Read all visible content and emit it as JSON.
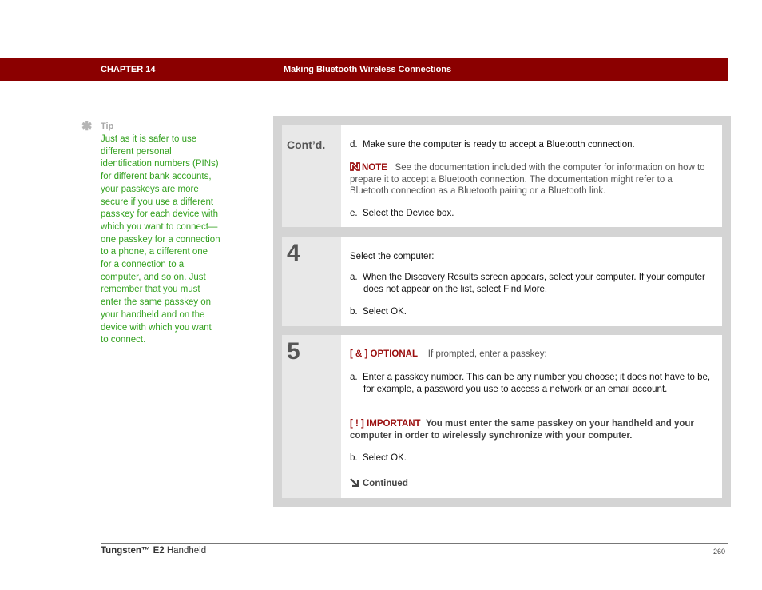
{
  "header": {
    "chapter": "CHAPTER 14",
    "title": "Making Bluetooth Wireless Connections",
    "bar_color": "#8b0000"
  },
  "tip": {
    "icon": "asterisk-icon",
    "label": "Tip",
    "text": "Just as it is safer to use different personal identification numbers (PINs) for different bank accounts, your passkeys are more secure if you use a different passkey for each device with which you want to connect—one passkey for a connection to a phone, a different one for a connection to a computer, and so on. Just remember that you must enter the same passkey on your handheld and on the device with which you want to connect.",
    "color": "#33a11f"
  },
  "steps": {
    "contd": {
      "label": "Cont’d.",
      "item_d": "d.  Make sure the computer is ready to accept a Bluetooth connection.",
      "note_label": "NOTE",
      "note_text": "See the documentation included with the computer for information on how to prepare it to accept a Bluetooth connection. The documentation might refer to a Bluetooth connection as a Bluetooth pairing or a Bluetooth link.",
      "item_e": "e.  Select the Device box."
    },
    "step4": {
      "number": "4",
      "intro": "Select the computer:",
      "item_a": "a.  When the Discovery Results screen appears, select your computer. If your computer does not appear on the list, select Find More.",
      "item_b": "b.  Select OK."
    },
    "step5": {
      "number": "5",
      "optional_label": "[ & ]  OPTIONAL",
      "optional_text": "If prompted, enter a passkey:",
      "item_a": "a.  Enter a passkey number. This can be any number you choose; it does not have to be, for example, a password you use to access a network or an email account.",
      "important_label": "[ ! ] IMPORTANT",
      "important_text": "You must enter the same passkey on your handheld and your computer in order to wirelessly synchronize with your computer.",
      "item_b": "b.  Select OK.",
      "continued": "Continued"
    }
  },
  "footer": {
    "product_bold": "Tungsten™ E2",
    "product_rest": " Handheld",
    "page_number": "260"
  }
}
